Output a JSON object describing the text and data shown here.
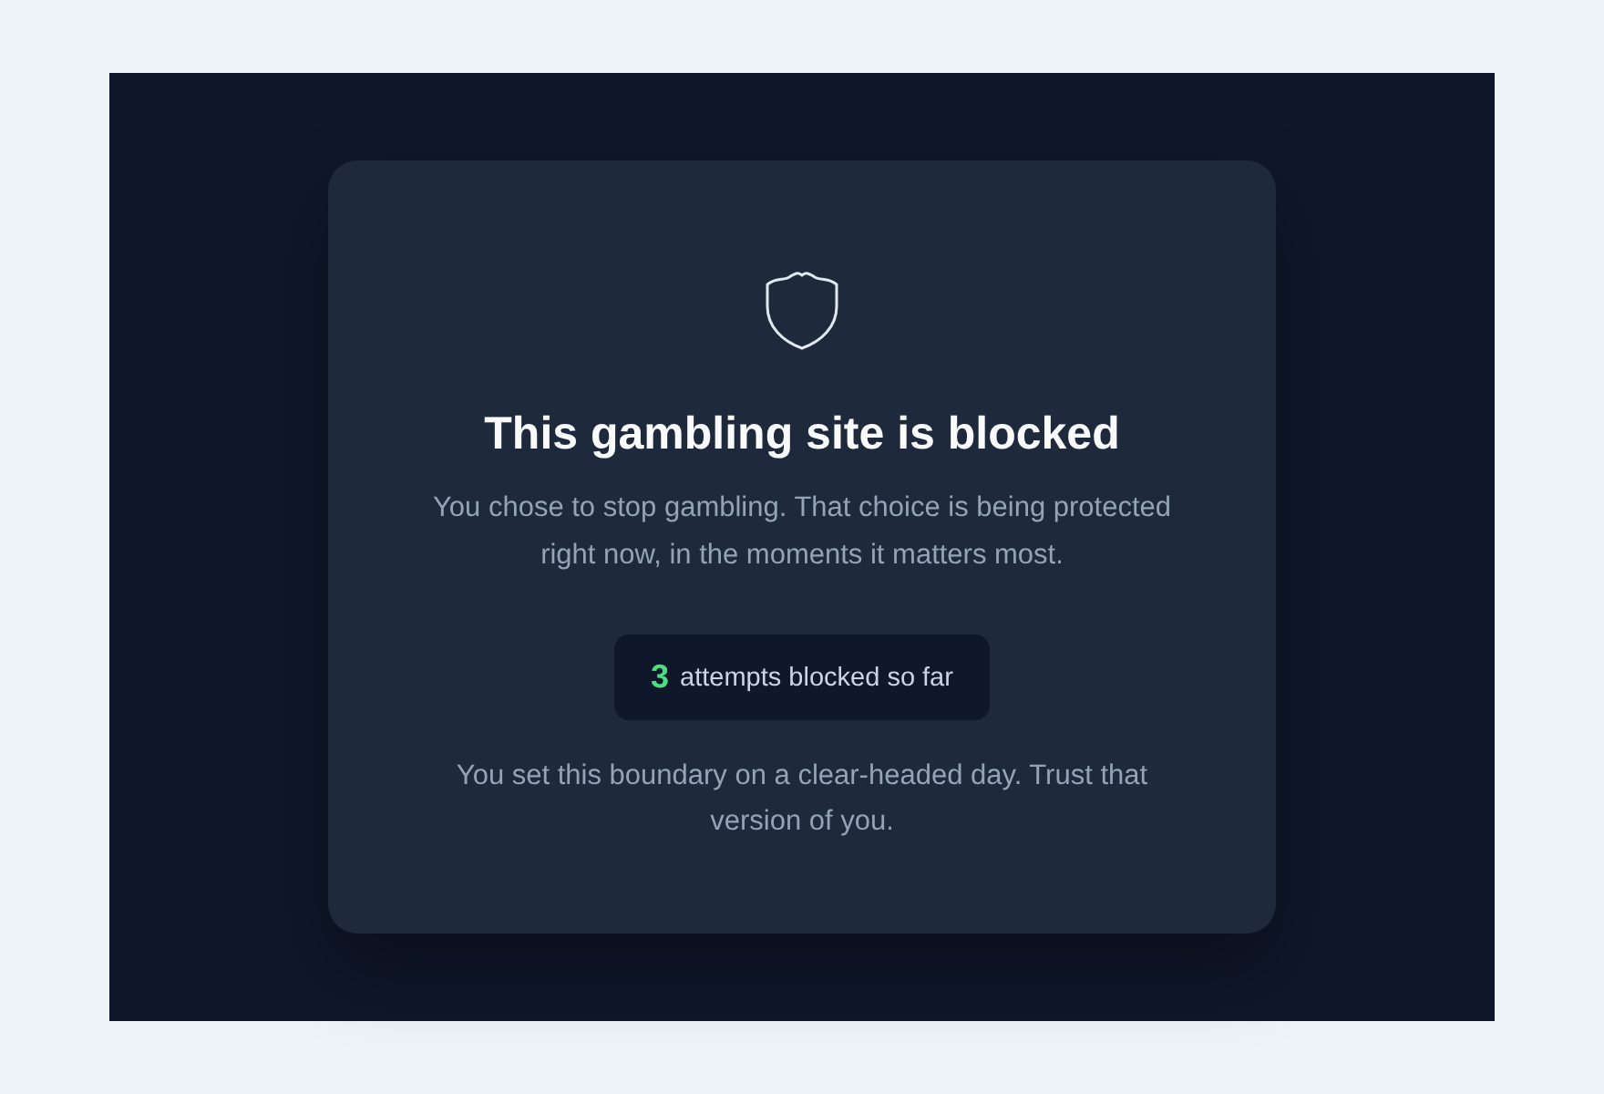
{
  "card": {
    "title": "This gambling site is blocked",
    "message": "You chose to stop gambling. That choice is being protected right now, in the moments it matters most.",
    "counter": {
      "count": "3",
      "label": "attempts blocked so far"
    },
    "footer": "You set this boundary on a clear-headed day. Trust that version of you."
  }
}
